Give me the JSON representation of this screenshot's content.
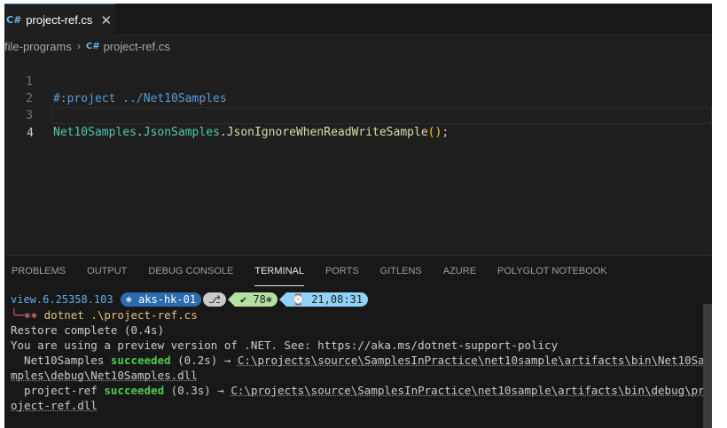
{
  "tab": {
    "label": "project-ref.cs",
    "close": "✕",
    "icon": "C#"
  },
  "breadcrumb": {
    "folder": "file-programs",
    "separator": "›",
    "file": "project-ref.cs"
  },
  "editor": {
    "lines": [
      {
        "number": "1",
        "text": "#:project ../Net10Samples"
      },
      {
        "number": "2",
        "text": ""
      },
      {
        "number": "3",
        "parts": [
          "Net10Samples",
          ".",
          "JsonSamples",
          ".",
          "JsonIgnoreWhenReadWriteSample",
          "(",
          ")",
          ";"
        ]
      },
      {
        "number": "4",
        "text": ""
      }
    ]
  },
  "panel": {
    "tabs": [
      "PROBLEMS",
      "OUTPUT",
      "DEBUG CONSOLE",
      "TERMINAL",
      "PORTS",
      "GITLENS",
      "AZURE",
      "POLYGLOT NOTEBOOK"
    ],
    "active_tab": "TERMINAL"
  },
  "terminal": {
    "prompt": {
      "path": "view.6.25358.103",
      "k8s": "⎈ aks-hk-01",
      "git": "⎇",
      "status": "✔ 78⎈",
      "time": "⌚ 21,08:31"
    },
    "command_prefix": "╰─⎈⎈",
    "command": "dotnet .\\project-ref.cs",
    "lines": [
      "Restore complete (0.4s)",
      "You are using a preview version of .NET. See: https://aka.ms/dotnet-support-policy"
    ],
    "build1": {
      "project": "  Net10Samples",
      "status": "succeeded",
      "time": " (0.2s) → ",
      "path_a": "C:\\projects\\source\\SamplesInPractice\\net10sample\\artifacts\\bin\\Net10Sa",
      "path_b": "mples\\debug\\Net10Samples.dll"
    },
    "build2": {
      "project": "  project-ref",
      "status": "succeeded",
      "time": " (0.3s) → ",
      "path_a": "C:\\projects\\source\\SamplesInPractice\\net10sample\\artifacts\\bin\\debug\\pr",
      "path_b": "oject-ref.dll"
    }
  },
  "colors": {
    "accent": "#0078d4",
    "success": "#4ec94e",
    "k8s_segment": "#2b6cb0",
    "status_segment": "#b5e0a1",
    "time_segment": "#8fd3f8"
  }
}
